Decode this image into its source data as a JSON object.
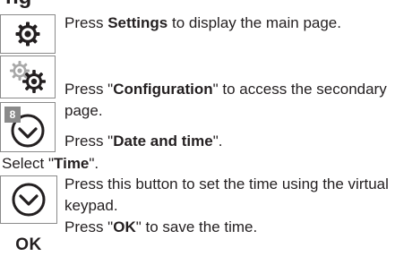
{
  "heading": "ng",
  "steps": [
    {
      "icon": "gear-icon",
      "pre": "Press ",
      "bold": "Settings",
      "post": " to display the main page."
    },
    {
      "icon": "gears-icon",
      "pre": "Press \"",
      "bold": "Configuration",
      "post": "\" to access the secondary page."
    },
    {
      "icon": "clock-icon",
      "badge": "8",
      "pre": "Press \"",
      "bold": "Date and time",
      "post": "\"."
    }
  ],
  "select": {
    "pre": "Select \"",
    "bold": "Time",
    "post": "\"."
  },
  "steps2": [
    {
      "icon": "chevron-down-circle-icon",
      "text": "Press this button to set the time using the virtual keypad."
    },
    {
      "icon": "ok-button-icon",
      "label": "OK",
      "pre": "Press \"",
      "bold": "OK",
      "post": "\" to save the time."
    }
  ]
}
